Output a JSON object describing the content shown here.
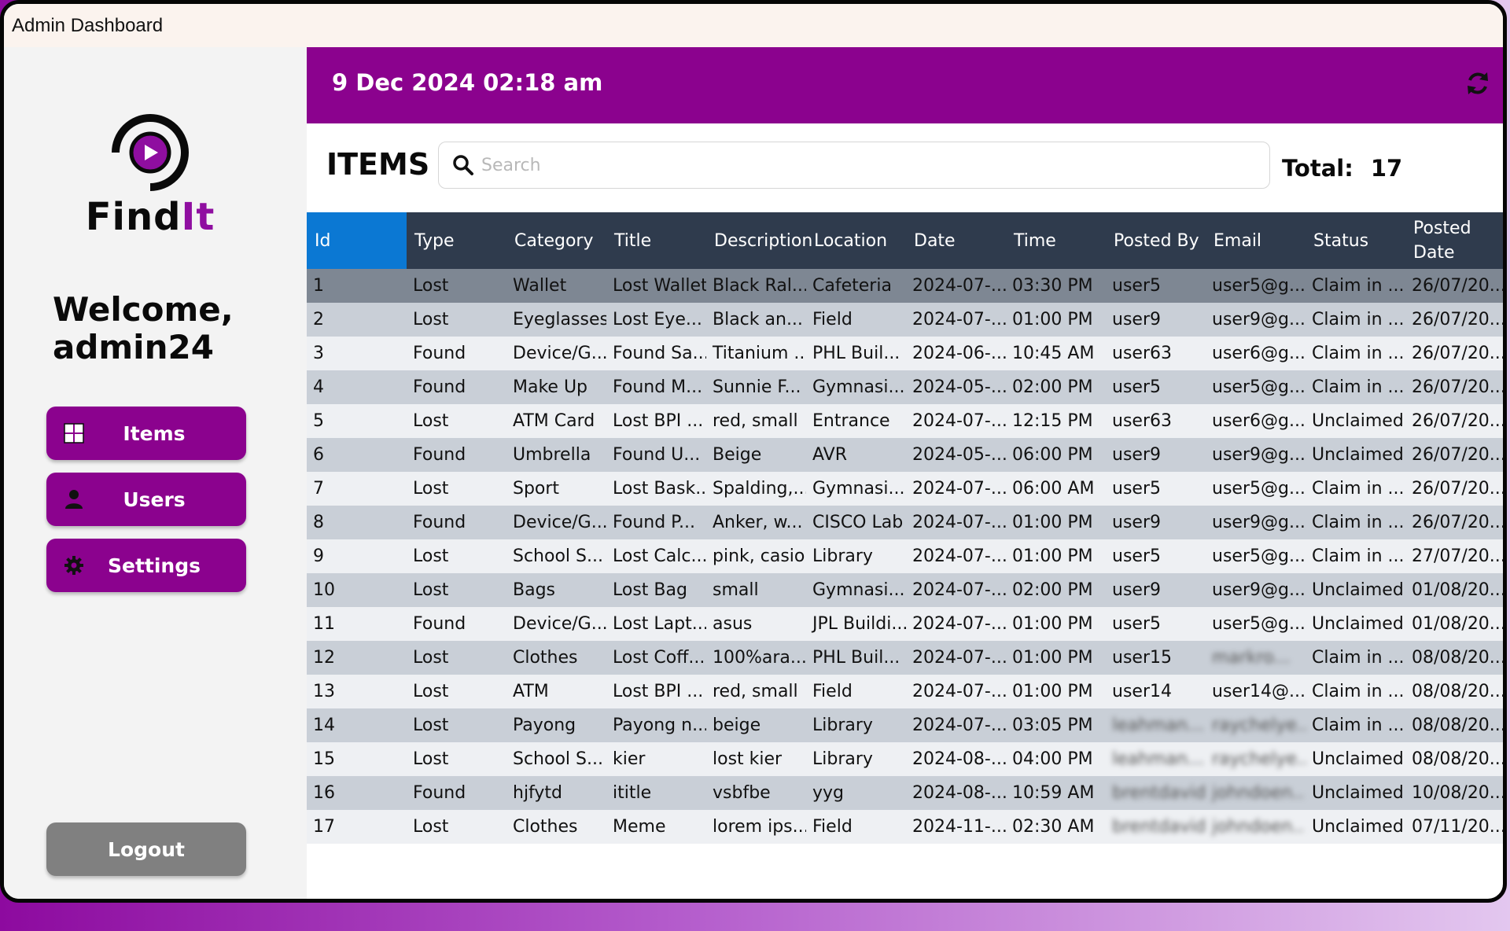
{
  "window": {
    "title": "Admin Dashboard"
  },
  "sidebar": {
    "logo": {
      "text_find": "Find",
      "text_it": "It",
      "icon": "play-circle-logo"
    },
    "welcome_line1": "Welcome,",
    "welcome_line2": "admin24",
    "nav": [
      {
        "label": "Items",
        "icon": "grid-icon"
      },
      {
        "label": "Users",
        "icon": "user-icon"
      },
      {
        "label": "Settings",
        "icon": "gear-icon"
      }
    ],
    "logout_label": "Logout"
  },
  "header": {
    "datetime": "9 Dec 2024 02:18 am",
    "refresh_icon": "refresh-icon"
  },
  "toolbar": {
    "title": "ITEMS",
    "search_placeholder": "Search",
    "search_icon": "search-icon",
    "total_label": "Total:",
    "total_value": "17"
  },
  "table": {
    "columns": [
      "Id",
      "Type",
      "Category",
      "Title",
      "Description",
      "Location",
      "Date",
      "Time",
      "Posted By",
      "Email",
      "Status",
      "Posted Date"
    ],
    "active_column": 0,
    "selected_row": 0,
    "rows": [
      [
        "1",
        "Lost",
        "Wallet",
        "Lost Wallet",
        "Black Ral...",
        "Cafeteria",
        "2024-07-...",
        "03:30 PM",
        "user5",
        "user5@g...",
        "Claim in ...",
        "26/07/20..."
      ],
      [
        "2",
        "Lost",
        "Eyeglasses",
        "Lost Eye...",
        "Black an...",
        "Field",
        "2024-07-...",
        "01:00 PM",
        "user9",
        "user9@g...",
        "Claim in ...",
        "26/07/20..."
      ],
      [
        "3",
        "Found",
        "Device/G...",
        "Found Sa...",
        "Titanium ...",
        "PHL Buil...",
        "2024-06-...",
        "10:45 AM",
        "user63",
        "user6@g...",
        "Claim in ...",
        "26/07/20..."
      ],
      [
        "4",
        "Found",
        "Make Up",
        "Found M...",
        "Sunnie F...",
        "Gymnasi...",
        "2024-05-...",
        "02:00 PM",
        "user5",
        "user5@g...",
        "Claim in ...",
        "26/07/20..."
      ],
      [
        "5",
        "Lost",
        "ATM Card",
        "Lost BPI ...",
        "red, small",
        "Entrance",
        "2024-07-...",
        "12:15 PM",
        "user63",
        "user6@g...",
        "Unclaimed",
        "26/07/20..."
      ],
      [
        "6",
        "Found",
        "Umbrella",
        "Found U...",
        "Beige",
        "AVR",
        "2024-05-...",
        "06:00 PM",
        "user9",
        "user9@g...",
        "Unclaimed",
        "26/07/20..."
      ],
      [
        "7",
        "Lost",
        "Sport",
        "Lost Bask...",
        "Spalding,...",
        "Gymnasi...",
        "2024-07-...",
        "06:00 AM",
        "user5",
        "user5@g...",
        "Claim in ...",
        "26/07/20..."
      ],
      [
        "8",
        "Found",
        "Device/G...",
        "Found P...",
        "Anker, w...",
        "CISCO Lab",
        "2024-07-...",
        "01:00 PM",
        "user9",
        "user9@g...",
        "Claim in ...",
        "26/07/20..."
      ],
      [
        "9",
        "Lost",
        "School S...",
        "Lost Calc...",
        "pink, casio",
        "Library",
        "2024-07-...",
        "01:00 PM",
        "user5",
        "user5@g...",
        "Claim in ...",
        "27/07/20..."
      ],
      [
        "10",
        "Lost",
        "Bags",
        "Lost Bag",
        "small",
        "Gymnasi...",
        "2024-07-...",
        "02:00 PM",
        "user9",
        "user9@g...",
        "Unclaimed",
        "01/08/20..."
      ],
      [
        "11",
        "Found",
        "Device/G...",
        "Lost Lapt...",
        "asus",
        "JPL Buildi...",
        "2024-07-...",
        "01:00 PM",
        "user5",
        "user5@g...",
        "Unclaimed",
        "01/08/20..."
      ],
      [
        "12",
        "Lost",
        "Clothes",
        "Lost Coff...",
        "100%ara...",
        "PHL Buil...",
        "2024-07-...",
        "01:00 PM",
        "user15",
        "markro...",
        "Claim in ...",
        "08/08/20..."
      ],
      [
        "13",
        "Lost",
        "ATM",
        "Lost BPI ...",
        "red, small",
        "Field",
        "2024-07-...",
        "01:00 PM",
        "user14",
        "user14@...",
        "Claim in ...",
        "08/08/20..."
      ],
      [
        "14",
        "Lost",
        "Payong",
        "Payong n...",
        "beige",
        "Library",
        "2024-07-...",
        "03:05 PM",
        "leahman...",
        "raychelye...",
        "Claim in ...",
        "08/08/20..."
      ],
      [
        "15",
        "Lost",
        "School S...",
        "kier",
        "lost kier",
        "Library",
        "2024-08-...",
        "04:00 PM",
        "leahman...",
        "raychelye...",
        "Unclaimed",
        "08/08/20..."
      ],
      [
        "16",
        "Found",
        "hjfytd",
        "ititle",
        "vsbfbe",
        "yyg",
        "2024-08-...",
        "10:59 AM",
        "brentdavid",
        "johndoen...",
        "Unclaimed",
        "10/08/20..."
      ],
      [
        "17",
        "Lost",
        "Clothes",
        "Meme",
        "lorem ips...",
        "Field",
        "2024-11-...",
        "02:30 AM",
        "brentdavid",
        "johndoen...",
        "Unclaimed",
        "07/11/20..."
      ]
    ],
    "blurred_cells": [
      [
        11,
        9
      ],
      [
        13,
        8
      ],
      [
        13,
        9
      ],
      [
        14,
        8
      ],
      [
        14,
        9
      ],
      [
        15,
        8
      ],
      [
        15,
        9
      ],
      [
        16,
        8
      ],
      [
        16,
        9
      ]
    ]
  },
  "colors": {
    "accent": "#8b028e",
    "header_dark": "#2f3b4d",
    "active_header": "#0b78d3",
    "row_even": "#c9cfd7",
    "row_odd": "#eef0f3",
    "row_selected": "#7e8793",
    "logout": "#808080"
  }
}
